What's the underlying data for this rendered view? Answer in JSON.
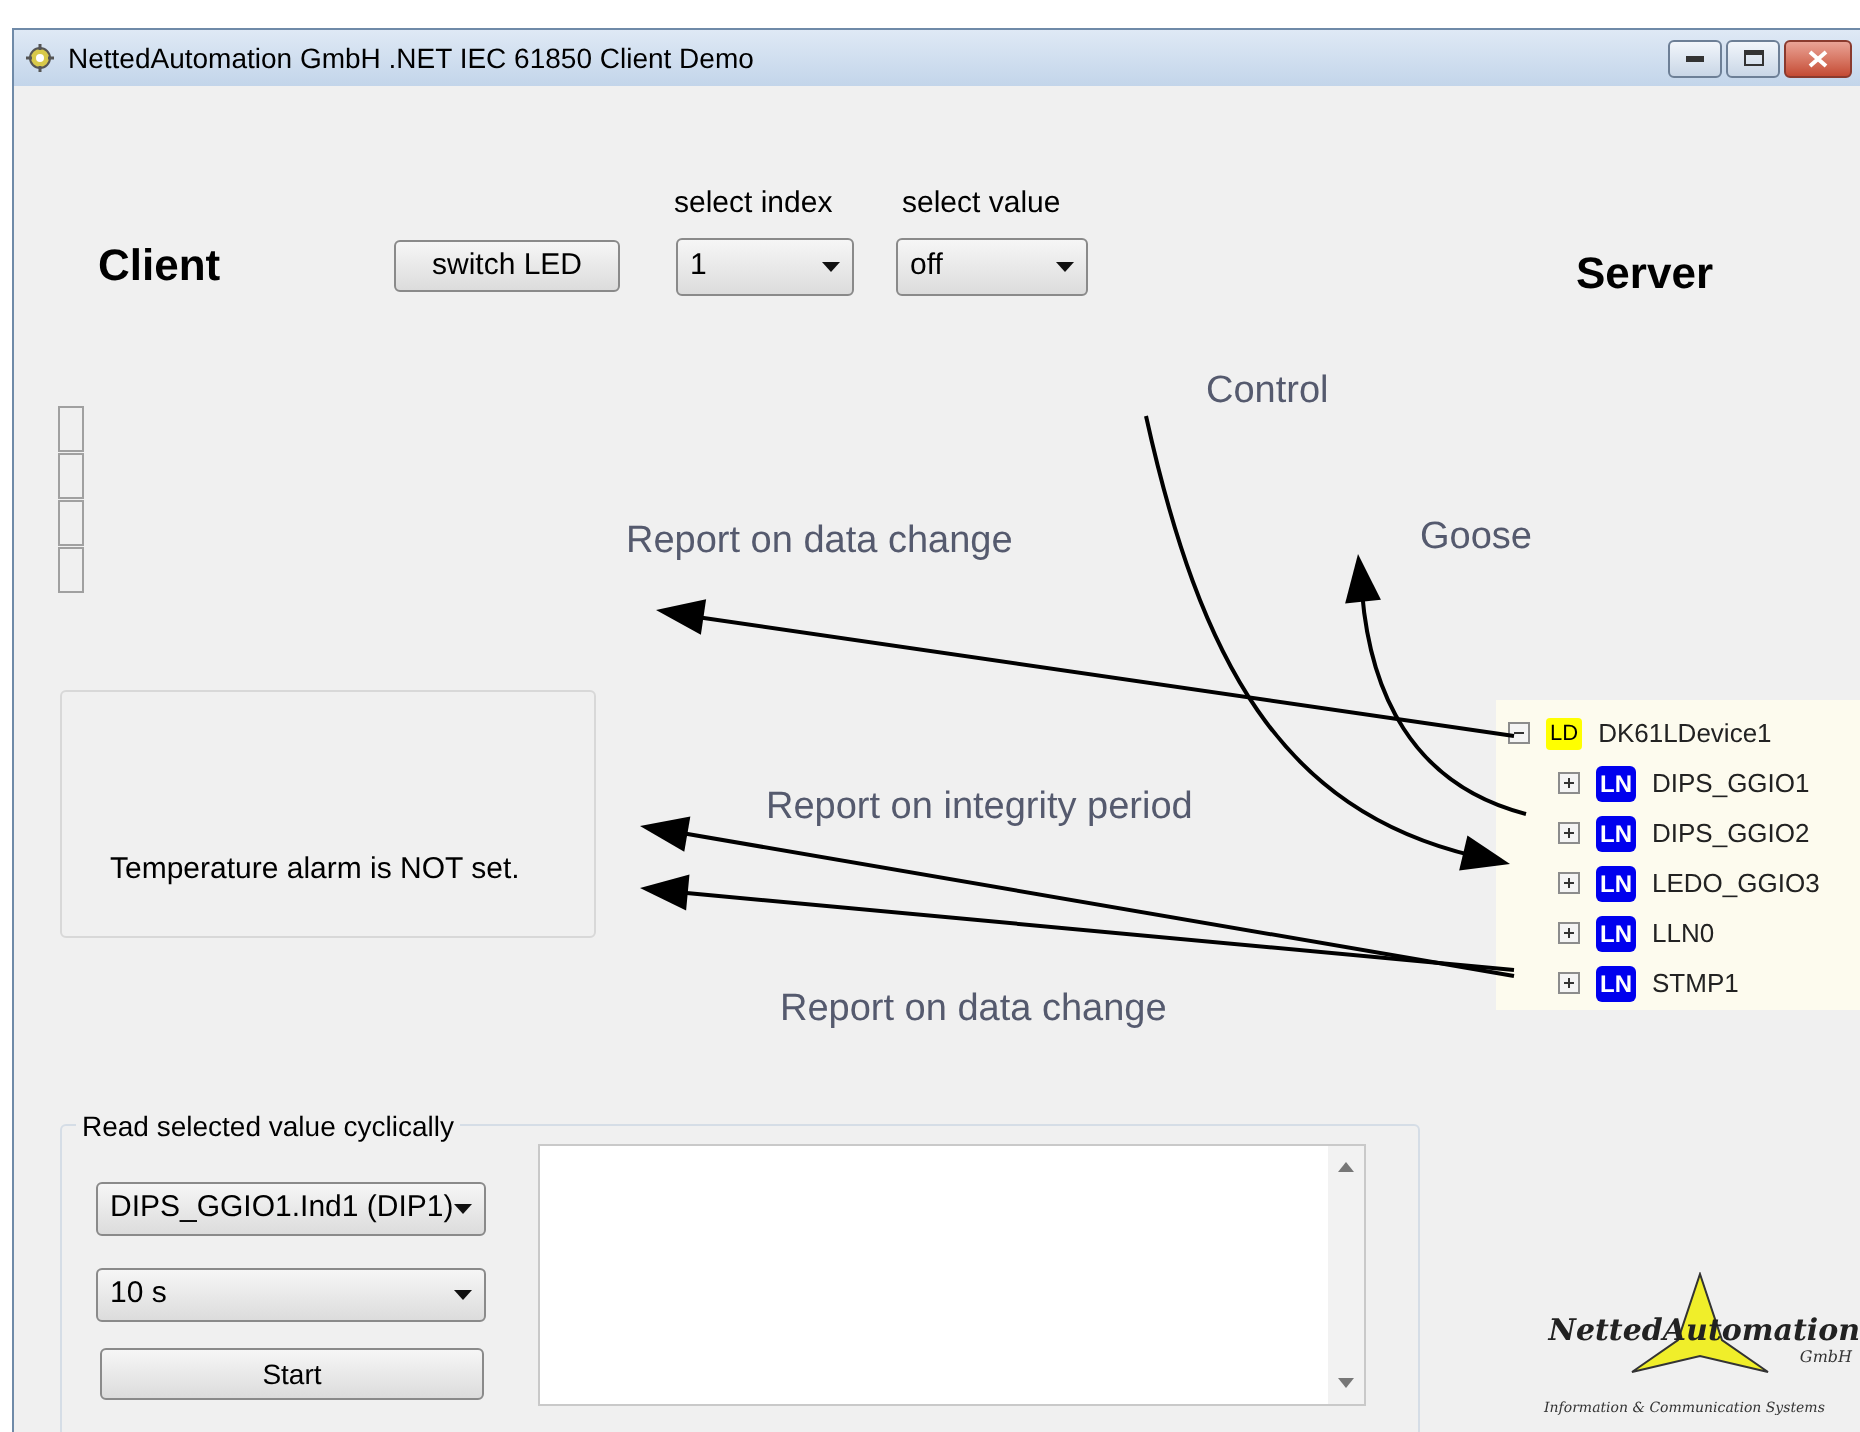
{
  "window": {
    "title": "NettedAutomation GmbH .NET IEC 61850 Client Demo"
  },
  "client_title": "Client",
  "server_title": "Server",
  "switch_button": "switch LED",
  "select_index": {
    "label": "select index",
    "value": "1"
  },
  "select_value": {
    "label": "select value",
    "value": "off"
  },
  "diagram_labels": [
    {
      "text": "Control"
    },
    {
      "text": "Report on data change"
    },
    {
      "text": "Goose"
    },
    {
      "text": "Report on integrity period"
    },
    {
      "text": "Report on data change"
    }
  ],
  "alarm_text": "Temperature alarm is NOT set.",
  "tree": {
    "badge": "LD",
    "label": "DK61LDevice1",
    "expanded": true,
    "children": [
      {
        "badge": "LN",
        "label": "DIPS_GGIO1",
        "expanded": false
      },
      {
        "badge": "LN",
        "label": "DIPS_GGIO2",
        "expanded": false
      },
      {
        "badge": "LN",
        "label": "LEDO_GGIO3",
        "expanded": false
      },
      {
        "badge": "LN",
        "label": "LLN0",
        "expanded": false
      },
      {
        "badge": "LN",
        "label": "STMP1",
        "expanded": false
      }
    ]
  },
  "cyclic_read": {
    "title": "Read selected value cyclically",
    "item_value": "DIPS_GGIO1.Ind1 (DIP1)",
    "interval_value": "10 s",
    "start_button": "Start"
  },
  "logo": {
    "name": "NettedAutomation",
    "suffix": "GmbH",
    "tagline": "Information & Communication Systems"
  }
}
